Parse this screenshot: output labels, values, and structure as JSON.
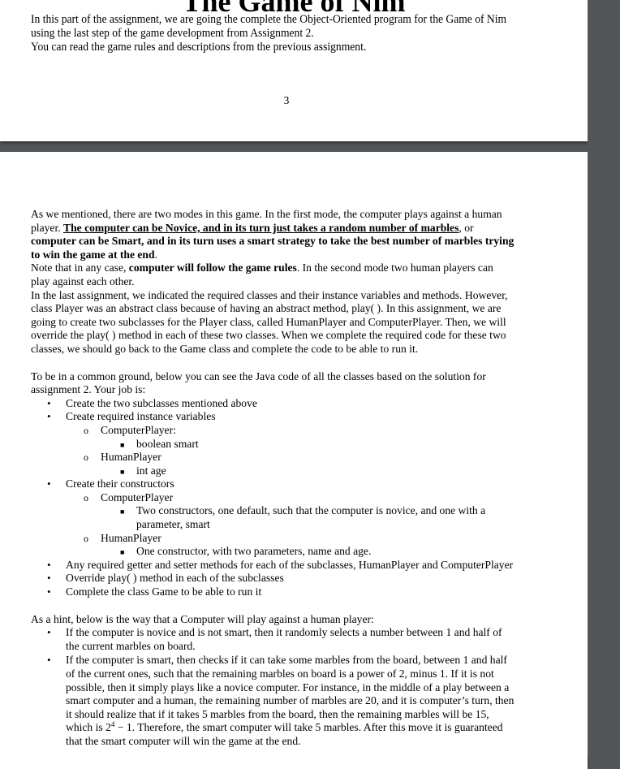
{
  "viewer": {
    "background_color": "#525659",
    "page_color": "#ffffff"
  },
  "page1": {
    "title": "The Game of Nim",
    "intro_lines": [
      "In this part of the assignment, we are going the complete the Object-Oriented program for the Game of Nim",
      "using the last step of the game development from Assignment 2.",
      "You can read the game rules and descriptions from the previous assignment."
    ],
    "page_number": "3"
  },
  "page2": {
    "modes": {
      "line1": "As we mentioned, there are two modes in this game. In the first mode, the computer plays against a human",
      "line2_prefix": "player. ",
      "line2_bold_underlined": "The computer can be Novice, and in its turn just takes a random number of marbles",
      "line2_suffix": ", or",
      "line3_bold": "computer can be Smart, and in its turn uses a smart strategy to take the best number of marbles trying",
      "line4_bold": "to win the game at the end",
      "line4_suffix": ".",
      "line5_prefix": "Note that in any case, ",
      "line5_bold": "computer will follow the game rules",
      "line5_suffix": ". In the second mode two human players can",
      "line6": "play against each other."
    },
    "classes_paragraph": [
      "In the last assignment, we indicated the required classes and their instance variables and methods. However,",
      "class Player was an abstract class because of having an abstract method, play( ). In this assignment, we are",
      "going to create two subclasses for the Player class, called HumanPlayer and ComputerPlayer. Then, we will",
      "override the play( ) method in each of these two classes. When we complete the required code for these two",
      "classes, we should go back to the Game class and complete the code to be able to run it."
    ],
    "job_intro": [
      "To be in a common ground, below you can see the Java code of all the classes based on the solution for",
      "assignment 2. Your job is:"
    ],
    "tasks": {
      "create_subclasses": "Create the two subclasses mentioned above",
      "instance_variables": {
        "label": "Create required instance variables",
        "computer_player": "ComputerPlayer:",
        "computer_player_var": "boolean smart",
        "human_player": "HumanPlayer",
        "human_player_var": "int age"
      },
      "constructors": {
        "label": "Create their constructors",
        "computer_player": "ComputerPlayer",
        "computer_player_desc_1": "Two constructors, one default, such that the computer is novice, and one with a",
        "computer_player_desc_2": "parameter, smart",
        "human_player": "HumanPlayer",
        "human_player_desc": "One constructor, with two parameters, name and age."
      },
      "getters_setters": "Any required getter and setter methods for each of the subclasses, HumanPlayer and ComputerPlayer",
      "override_play": "Override play( ) method in each of the subclasses",
      "complete_game": "Complete the class Game to be able to run it"
    },
    "hint": {
      "intro": "As a hint, below is the way that a Computer will play against a human player:",
      "novice_lines": [
        "If the computer is novice and is not smart, then it randomly selects a number between 1 and half of",
        "the current marbles on board."
      ],
      "smart_lines": [
        "If the computer is smart, then checks if it can take some marbles from the board, between 1 and half",
        "of the current ones, such that the remaining marbles on board is a power of 2, minus 1. If it is not",
        "possible, then it simply plays like a novice computer. For instance, in the middle of a play between a",
        "smart computer and a human, the remaining number of marbles are 20, and it is computer’s turn, then",
        "it should realize that if it takes 5 marbles from the board, then the remaining marbles will be 15,"
      ],
      "formula_prefix": "which is 2",
      "formula_exponent": "4",
      "formula_suffix": " − 1. Therefore, the smart computer will take 5 marbles. After this move it is guaranteed",
      "last_line": "that the smart computer will win the game at the end."
    }
  },
  "icons": {
    "bullet": "•",
    "sub_bullet": "o",
    "square_bullet": "■"
  }
}
